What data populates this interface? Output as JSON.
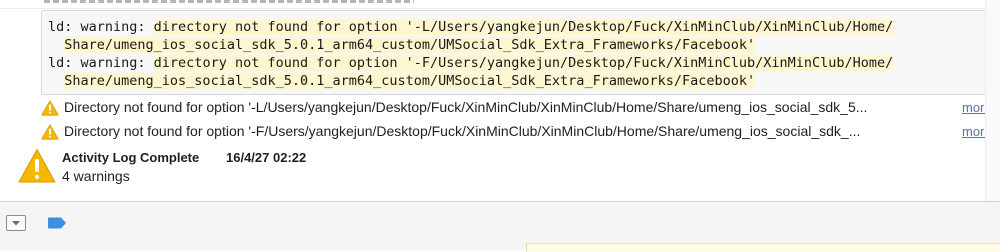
{
  "transcript": {
    "lines": [
      {
        "prefix": "ld: warning: ",
        "text": "directory not found for option '-L/Users/yangkejun/Desktop/Fuck/XinMinClub/XinMinClub/Home/"
      },
      {
        "prefix": "  ",
        "text": "Share/umeng_ios_social_sdk_5.0.1_arm64_custom/UMSocial_Sdk_Extra_Frameworks/Facebook'"
      },
      {
        "prefix": "ld: warning: ",
        "text": "directory not found for option '-F/Users/yangkejun/Desktop/Fuck/XinMinClub/XinMinClub/Home/"
      },
      {
        "prefix": "  ",
        "text": "Share/umeng_ios_social_sdk_5.0.1_arm64_custom/UMSocial_Sdk_Extra_Frameworks/Facebook'"
      }
    ]
  },
  "warnings": [
    {
      "text": "Directory not found for option '-L/Users/yangkejun/Desktop/Fuck/XinMinClub/XinMinClub/Home/Share/umeng_ios_social_sdk_5...",
      "more": "more",
      "icon": "warning-icon"
    },
    {
      "text": "Directory not found for option '-F/Users/yangkejun/Desktop/Fuck/XinMinClub/XinMinClub/Home/Share/umeng_ios_social_sdk_...",
      "more": "more",
      "icon": "warning-icon"
    }
  ],
  "summary": {
    "title": "Activity Log Complete",
    "time": "16/4/27 02:22",
    "count": "4 warnings",
    "icon": "warning-icon"
  },
  "bottom_bar": {
    "toggle_icon": "toggle-debug-area-icon",
    "tag_icon": "breakpoint-tag-icon"
  },
  "colors": {
    "highlight": "#fdf6cf",
    "warning_yellow": "#f5b800",
    "link": "#5f6fb0",
    "breakpoint_blue": "#3d8fe0"
  }
}
